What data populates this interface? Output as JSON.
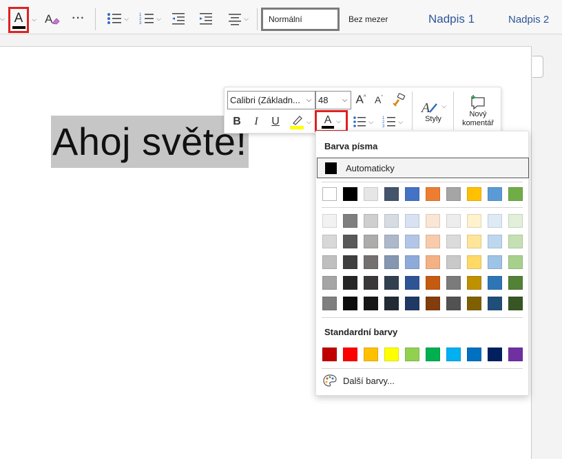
{
  "ribbon": {
    "styles": [
      "Normální",
      "Bez mezer",
      "Nadpis 1",
      "Nadpis 2"
    ],
    "more_label": "···"
  },
  "document": {
    "text": "Ahoj světe!"
  },
  "mini_toolbar": {
    "font_name": "Calibri (Základn...",
    "font_size": "48",
    "styles_label": "Styly",
    "comment_label_1": "Nový",
    "comment_label_2": "komentář"
  },
  "color_panel": {
    "title": "Barva písma",
    "automatic_label": "Automaticky",
    "theme_colors": [
      "#ffffff",
      "#000000",
      "#e7e6e6",
      "#44546a",
      "#4472c4",
      "#ed7d31",
      "#a5a5a5",
      "#ffc000",
      "#5b9bd5",
      "#70ad47"
    ],
    "shade_rows": [
      [
        "#f2f2f2",
        "#7f7f7f",
        "#d0cece",
        "#d6dce4",
        "#d9e2f3",
        "#fbe5d5",
        "#ededed",
        "#fff2cc",
        "#deebf6",
        "#e2efd9"
      ],
      [
        "#d8d8d8",
        "#595959",
        "#aeabab",
        "#adb9ca",
        "#b4c6e7",
        "#f7cbac",
        "#dbdbdb",
        "#fee599",
        "#bdd7ee",
        "#c5e0b3"
      ],
      [
        "#bfbfbf",
        "#3f3f3f",
        "#757070",
        "#8496b0",
        "#8eaadb",
        "#f4b183",
        "#c9c9c9",
        "#ffd965",
        "#9dc3e6",
        "#a8d08d"
      ],
      [
        "#a5a5a5",
        "#262626",
        "#3a3838",
        "#323f4f",
        "#2f5496",
        "#c55a11",
        "#7b7b7b",
        "#bf9000",
        "#2e75b5",
        "#538135"
      ],
      [
        "#7f7f7f",
        "#0c0c0c",
        "#171616",
        "#222a35",
        "#1f3864",
        "#833c0b",
        "#525252",
        "#7f6000",
        "#1f4e79",
        "#375623"
      ]
    ],
    "standard_title": "Standardní barvy",
    "standard_colors": [
      "#c00000",
      "#ff0000",
      "#ffc000",
      "#ffff00",
      "#92d050",
      "#00b050",
      "#00b0f0",
      "#0070c0",
      "#002060",
      "#7030a0"
    ],
    "more_colors_label": "Další barvy..."
  },
  "colors": {
    "highlight_marker": "#ffff00",
    "font_color_bar": "#000000",
    "callout_red": "#e02020",
    "heading_blue": "#2f5597"
  }
}
